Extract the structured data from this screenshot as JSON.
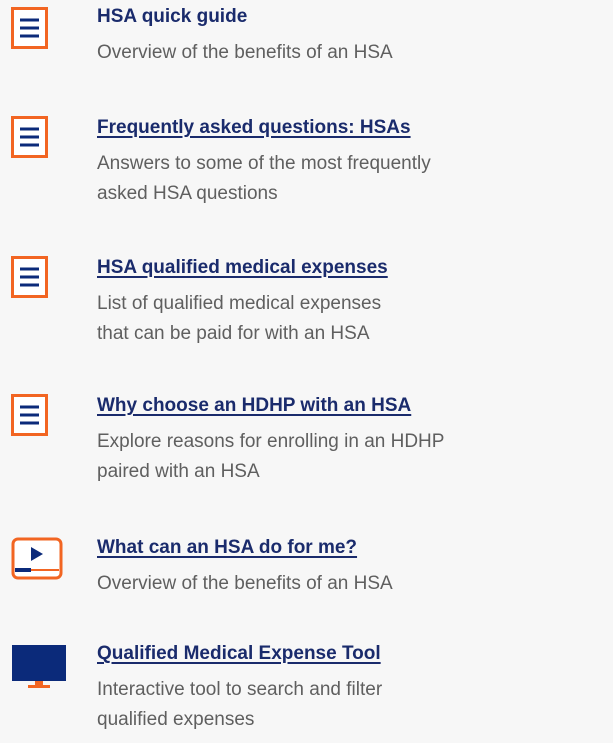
{
  "resources": [
    {
      "icon": "document-icon",
      "title": "HSA quick guide",
      "description_lines": [
        "Overview of the benefits of an HSA"
      ]
    },
    {
      "icon": "document-icon",
      "title": "Frequently asked questions: HSAs",
      "description_lines": [
        "Answers to some of the most frequently",
        "asked HSA questions"
      ]
    },
    {
      "icon": "document-icon",
      "title": "HSA qualified medical expenses",
      "description_lines": [
        "List of qualified medical expenses",
        "that can be paid for with an HSA"
      ]
    },
    {
      "icon": "document-icon",
      "title": "Why choose an HDHP with an HSA",
      "description_lines": [
        "Explore reasons for enrolling in an HDHP",
        "paired with an HSA"
      ]
    },
    {
      "icon": "video-icon",
      "title": "What can an HSA do for me?",
      "description_lines": [
        "Overview of the benefits of an HSA"
      ]
    },
    {
      "icon": "monitor-icon",
      "title": "Qualified Medical Expense Tool",
      "description_lines": [
        "Interactive tool to search and filter",
        "qualified expenses"
      ]
    }
  ],
  "colors": {
    "accent_orange": "#f26522",
    "navy": "#0b2a7a",
    "title_text": "#1a2b6c",
    "body_text": "#5f5f5f",
    "background": "#f7f7f7"
  }
}
